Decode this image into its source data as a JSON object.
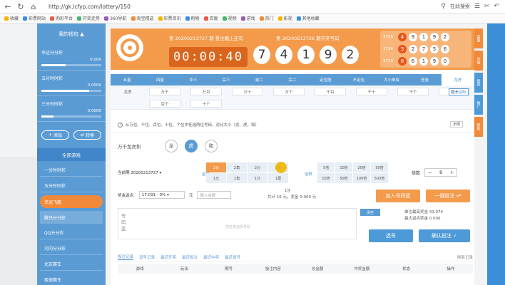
{
  "browser": {
    "back_icon": "back-arrow-icon",
    "url": "http://gk.lcfyp.com/lottery/150",
    "search_placeholder": "在此搜索",
    "bookmarks": [
      "收藏",
      "彩票网站",
      "购彩平台",
      "开奖走势",
      "360导航",
      "淘宝精选",
      "彩票资讯",
      "购物",
      "百度",
      "视频",
      "游戏",
      "热门",
      "影视",
      "其他收藏"
    ]
  },
  "sidebar": {
    "header": "我的钱包",
    "wallets": [
      {
        "name": "幸运分分彩",
        "value": "0.000",
        "fill": 0.4
      },
      {
        "name": "五分时时彩",
        "value": "0.0000",
        "fill": 0.8
      },
      {
        "name": "三分时时彩",
        "value": "0.0000",
        "fill": 0.2
      }
    ],
    "buttons": {
      "add": "添加",
      "transfer": "转换"
    },
    "all_games": "全部游戏",
    "links": [
      "一分时时彩",
      "五分时时彩",
      "幸运飞艇",
      "腾讯分分彩",
      "QQ分分彩",
      "河内分分彩",
      "北京赛车",
      "极速赛车"
    ],
    "active_index": 2,
    "sub_index": 3
  },
  "banner": {
    "issue_label": "第 20200213727 期 投注截止还有",
    "timer": "00:00:40",
    "prev_label": "第 20200213726 期开奖号码",
    "draw": [
      "7",
      "4",
      "1",
      "9",
      "2"
    ],
    "history": [
      {
        "issue": "3725",
        "balls": [
          "4",
          "9",
          "1",
          "9",
          "2"
        ]
      },
      {
        "issue": "3724",
        "balls": [
          "3",
          "2",
          "7",
          "5",
          "6"
        ]
      },
      {
        "issue": "3723",
        "balls": [
          "8",
          "6",
          "1",
          "9",
          "0"
        ]
      }
    ]
  },
  "tabs": [
    "五星",
    "四星",
    "中三",
    "后三",
    "前二",
    "后二",
    "定位胆",
    "不定位",
    "大小单双",
    "任选",
    "龙虎"
  ],
  "active_tab": 10,
  "subtabs": {
    "row1_label": "龙虎",
    "row1": [
      "万千",
      "万百",
      "万十",
      "万个",
      "千百",
      "千十",
      "千个",
      "百十"
    ],
    "row2": [
      "百个",
      "十个"
    ],
    "intro": "玩法说明"
  },
  "notice": {
    "text": "从万位、千位、百位、十位、个位中任选两位号码，对比大小（龙、虎、和）",
    "example": "示例"
  },
  "ldh": {
    "label": "万千龙虎和",
    "options": [
      "龙",
      "虎",
      "和"
    ],
    "selected": 1
  },
  "bet": {
    "period": "当前期 20200213727",
    "unit_label": "金额",
    "units": [
      "2元",
      "2角",
      "2分",
      "2厘",
      "1元",
      "1角",
      "1分",
      "1厘"
    ],
    "unit_selected": 0,
    "mult_label": "倍数",
    "mults": [
      "5倍",
      "10倍",
      "20倍",
      "50倍",
      "10倍",
      "50倍",
      "100倍",
      "500倍"
    ],
    "stepper_label": "倍数",
    "stepper_minus": "−",
    "stepper_value": "8",
    "stepper_plus": "+"
  },
  "rebate": {
    "label": "奖金返点:",
    "value": "17.031 - 0%",
    "unit": "元",
    "input_placeholder": "输入金额"
  },
  "totals": {
    "text": "共计 16 元，奖金 0.000 元",
    "small": "1注"
  },
  "buttons": {
    "add_cart": "加入号码篮",
    "quick_bet": "一键投注",
    "select": "选号",
    "confirm": "确认投注"
  },
  "entry": {
    "label": "号码篮",
    "placeholder": "您还未选择号码",
    "clear": "清空"
  },
  "max_prize": {
    "label": "单注最高奖金",
    "value": "43.074",
    "detail": "最大返点奖金 0.000"
  },
  "records": {
    "tabs": [
      "投注记录",
      "追号记录",
      "最近开奖",
      "最近投注",
      "最近中奖",
      "最近追号"
    ],
    "refresh": "刷新记录",
    "columns": [
      "游戏",
      "玩法",
      "期号",
      "投注内容",
      "总金额",
      "中奖金额",
      "状态",
      "操作"
    ]
  },
  "right_tabs": [
    "客服",
    "充值",
    "提现",
    "推广",
    "帮助"
  ]
}
